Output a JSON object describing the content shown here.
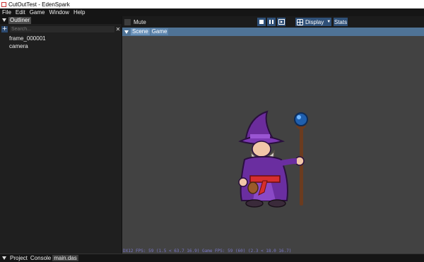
{
  "window": {
    "title": "CutOutTest - EdenSpark"
  },
  "menu": [
    "File",
    "Edit",
    "Game",
    "Window",
    "Help"
  ],
  "outliner": {
    "tab_label": "Outliner",
    "search_placeholder": "Search...",
    "add_label": "+",
    "clear_label": "✕",
    "items": [
      "frame_000001",
      "camera"
    ]
  },
  "toolbar": {
    "mute_label": "Mute",
    "display_label": "Display",
    "stats_label": "Stats"
  },
  "view_tabs": [
    "Scene",
    "Game"
  ],
  "viewport": {
    "fps_text": "DX12 FPS: 59 (1.5 < 63.7 16.9) Game FPS: 59 (60) (2.3 < 18.0 16.7)"
  },
  "bottom_tabs": [
    "Project",
    "Console",
    "main.das"
  ],
  "colors": {
    "accent": "#2f5078",
    "viewport_bg": "#424242",
    "tab_bar": "#4f7396"
  }
}
